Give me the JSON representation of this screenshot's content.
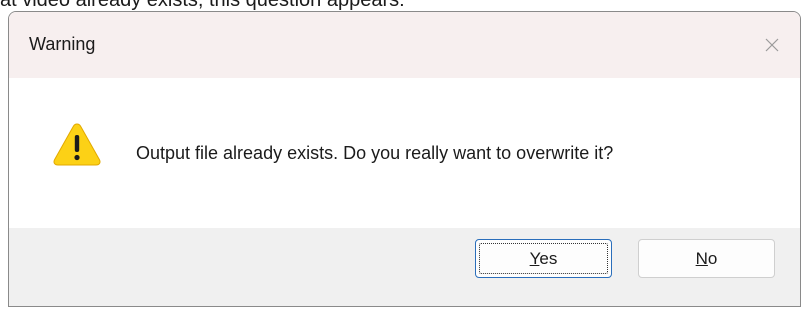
{
  "background_text": "at video already exists, this question appears:",
  "dialog": {
    "title": "Warning",
    "message": "Output file already exists. Do you really want to overwrite it?",
    "buttons": {
      "yes": {
        "mnemonic": "Y",
        "rest": "es"
      },
      "no": {
        "mnemonic": "N",
        "rest": "o"
      }
    }
  },
  "icons": {
    "warning": "warning-triangle-icon",
    "close": "close-icon"
  },
  "colors": {
    "titlebar": "#f7efef",
    "footer": "#f0f0f0",
    "warning_fill": "#fcd116",
    "default_button_border": "#2a6ebb"
  }
}
